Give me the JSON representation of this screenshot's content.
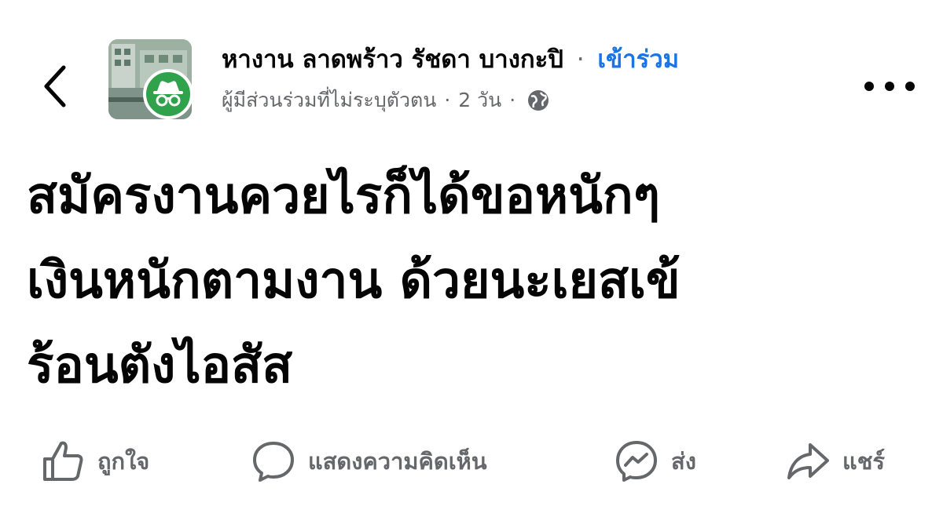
{
  "post_header": {
    "group_name": "หางาน ลาดพร้าว รัชดา บางกะปิ",
    "separator": "·",
    "join_label": "เข้าร่วม",
    "author": "ผู้มีส่วนร่วมที่ไม่ระบุตัวตน",
    "time": "2 วัน",
    "dot": "·",
    "privacy_icon": "globe-icon"
  },
  "post": {
    "lines": [
      "สมัครงานควยไรก็ได้ขอหนักๆ",
      "เงินหนักตามงาน ด้วยนะเยสเข้",
      "ร้อนตังไอสัส"
    ]
  },
  "actions": {
    "like_label": "ถูกใจ",
    "comment_label": "แสดงความคิดเห็น",
    "send_label": "ส่ง",
    "share_label": "แชร์"
  },
  "colors": {
    "link": "#1b74e4",
    "muted": "#65676b",
    "anonymous_badge": "#31a24c",
    "text": "#050505"
  }
}
